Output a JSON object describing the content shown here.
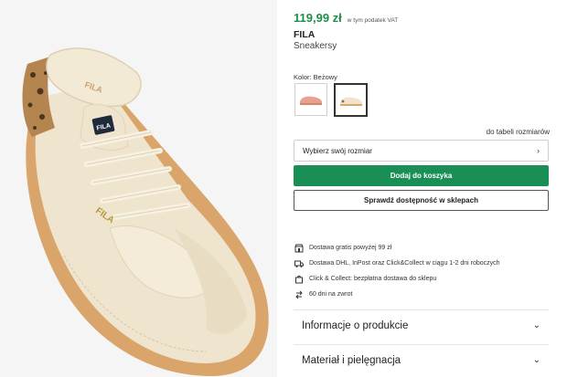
{
  "product": {
    "price": "119,99 zł",
    "vat_note": "w tym podatek VAT",
    "brand": "FILA",
    "name": "Sneakersy",
    "color_label": "Kolor: Beżowy",
    "swatches": [
      {
        "name": "pink-sneaker",
        "color": "#e8a090",
        "selected": false
      },
      {
        "name": "beige-sneaker",
        "color": "#efe3cc",
        "selected": true
      }
    ]
  },
  "size": {
    "table_link": "do tabeli rozmiarów",
    "select_placeholder": "Wybierz swój rozmiar"
  },
  "actions": {
    "add_to_cart": "Dodaj do koszyka",
    "check_availability": "Sprawdź dostępność w sklepach"
  },
  "features": [
    {
      "icon": "store-icon",
      "text": "Dostawa gratis powyżej 99 zł"
    },
    {
      "icon": "truck-icon",
      "text": "Dostawa DHL, InPost oraz Click&Collect w ciągu 1-2 dni roboczych"
    },
    {
      "icon": "bag-icon",
      "text": "Click & Collect: bezpłatna dostawa do sklepu"
    },
    {
      "icon": "return-icon",
      "text": "60 dni na zwrot"
    }
  ],
  "accordions": [
    {
      "label": "Informacje o produkcie"
    },
    {
      "label": "Materiał i pielęgnacja"
    }
  ],
  "colors": {
    "price_green": "#1a8f4a",
    "button_green": "#1a8f55"
  }
}
